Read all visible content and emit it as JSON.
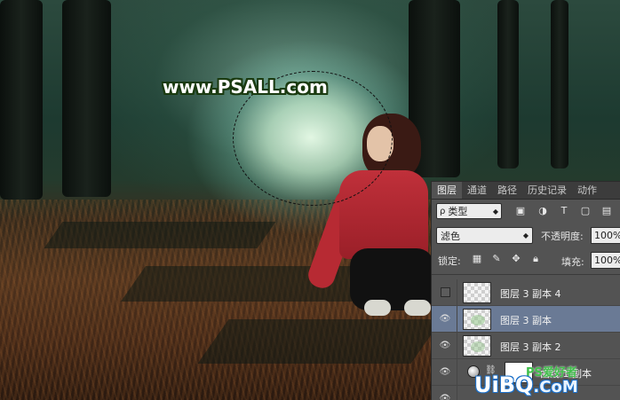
{
  "image": {
    "watermark_text": "www.PSALL.com",
    "bottom_watermark_main": "UiBQ",
    "bottom_watermark_suffix": ".CoM",
    "ps_mark": "PS爱好者"
  },
  "layers_panel": {
    "tabs": [
      {
        "label": "图层",
        "active": true
      },
      {
        "label": "通道",
        "active": false
      },
      {
        "label": "路径",
        "active": false
      },
      {
        "label": "历史记录",
        "active": false
      },
      {
        "label": "动作",
        "active": false
      }
    ],
    "filter_kind": "类型",
    "filter_icons": [
      "image-filter-icon",
      "adjustment-filter-icon",
      "text-filter-icon",
      "shape-filter-icon",
      "smart-object-filter-icon"
    ],
    "blend_mode": "滤色",
    "opacity_label": "不透明度:",
    "opacity_value": "100%",
    "lock_label": "锁定:",
    "lock_icons": [
      "lock-transparent-icon",
      "lock-paint-icon",
      "lock-position-icon",
      "lock-all-icon"
    ],
    "fill_label": "填充:",
    "fill_value": "100%",
    "layers": [
      {
        "name": "图层 3 副本 4",
        "visible": false,
        "selected": false
      },
      {
        "name": "图层 3 副本",
        "visible": true,
        "selected": true
      },
      {
        "name": "图层 3 副本 2",
        "visible": true,
        "selected": false
      },
      {
        "name": "曲线 1 副本",
        "visible": true,
        "selected": false,
        "type": "adjustment"
      }
    ]
  }
}
